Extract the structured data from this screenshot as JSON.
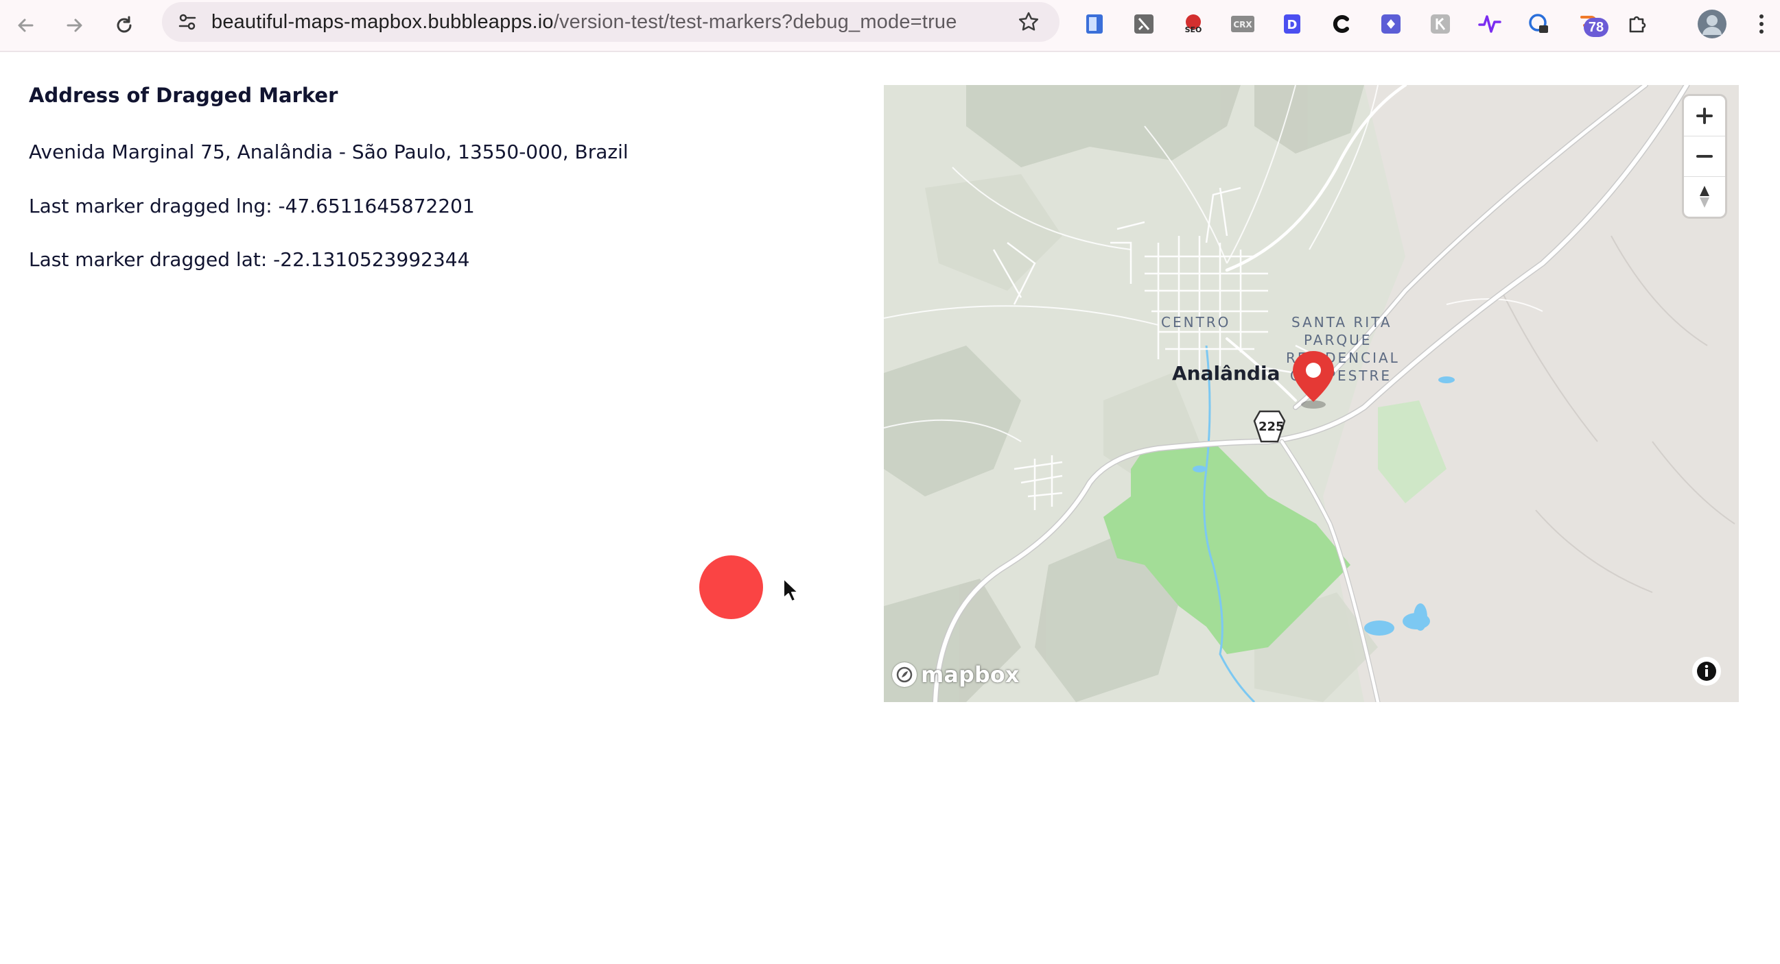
{
  "browser": {
    "url_host": "beautiful-maps-mapbox.bubbleapps.io",
    "url_path": "/version-test/test-markers?debug_mode=true",
    "extension_badge_count": "78",
    "icons": [
      "back-arrow-icon",
      "forward-arrow-icon",
      "reload-icon",
      "site-settings-icon",
      "bookmark-star-icon",
      "extensions-puzzle-icon",
      "profile-avatar",
      "more-menu-icon"
    ]
  },
  "page": {
    "title": "Address of Dragged Marker",
    "address": "Avenida Marginal 75, Analândia - São Paulo, 13550-000, Brazil",
    "lng_line": "Last marker dragged lng: -47.6511645872201",
    "lat_line": "Last marker dragged lat: -22.1310523992344",
    "dot_color": "#fa4444"
  },
  "map": {
    "labels": {
      "district_centro": "CENTRO",
      "district_santa_rita_1": "SANTA RITA",
      "district_santa_rita_2": "PARQUE",
      "district_santa_rita_3": "RESIDENCIAL",
      "district_santa_rita_4": "CAMPESTRE",
      "town": "Analândia",
      "route_shield": "225"
    },
    "brand": "mapbox",
    "marker_color": "#e53935",
    "park_color": "#a3dd97",
    "water_color": "#7cc8f2",
    "controls": [
      "zoom-in-icon",
      "zoom-out-icon",
      "compass-icon",
      "info-icon"
    ]
  }
}
